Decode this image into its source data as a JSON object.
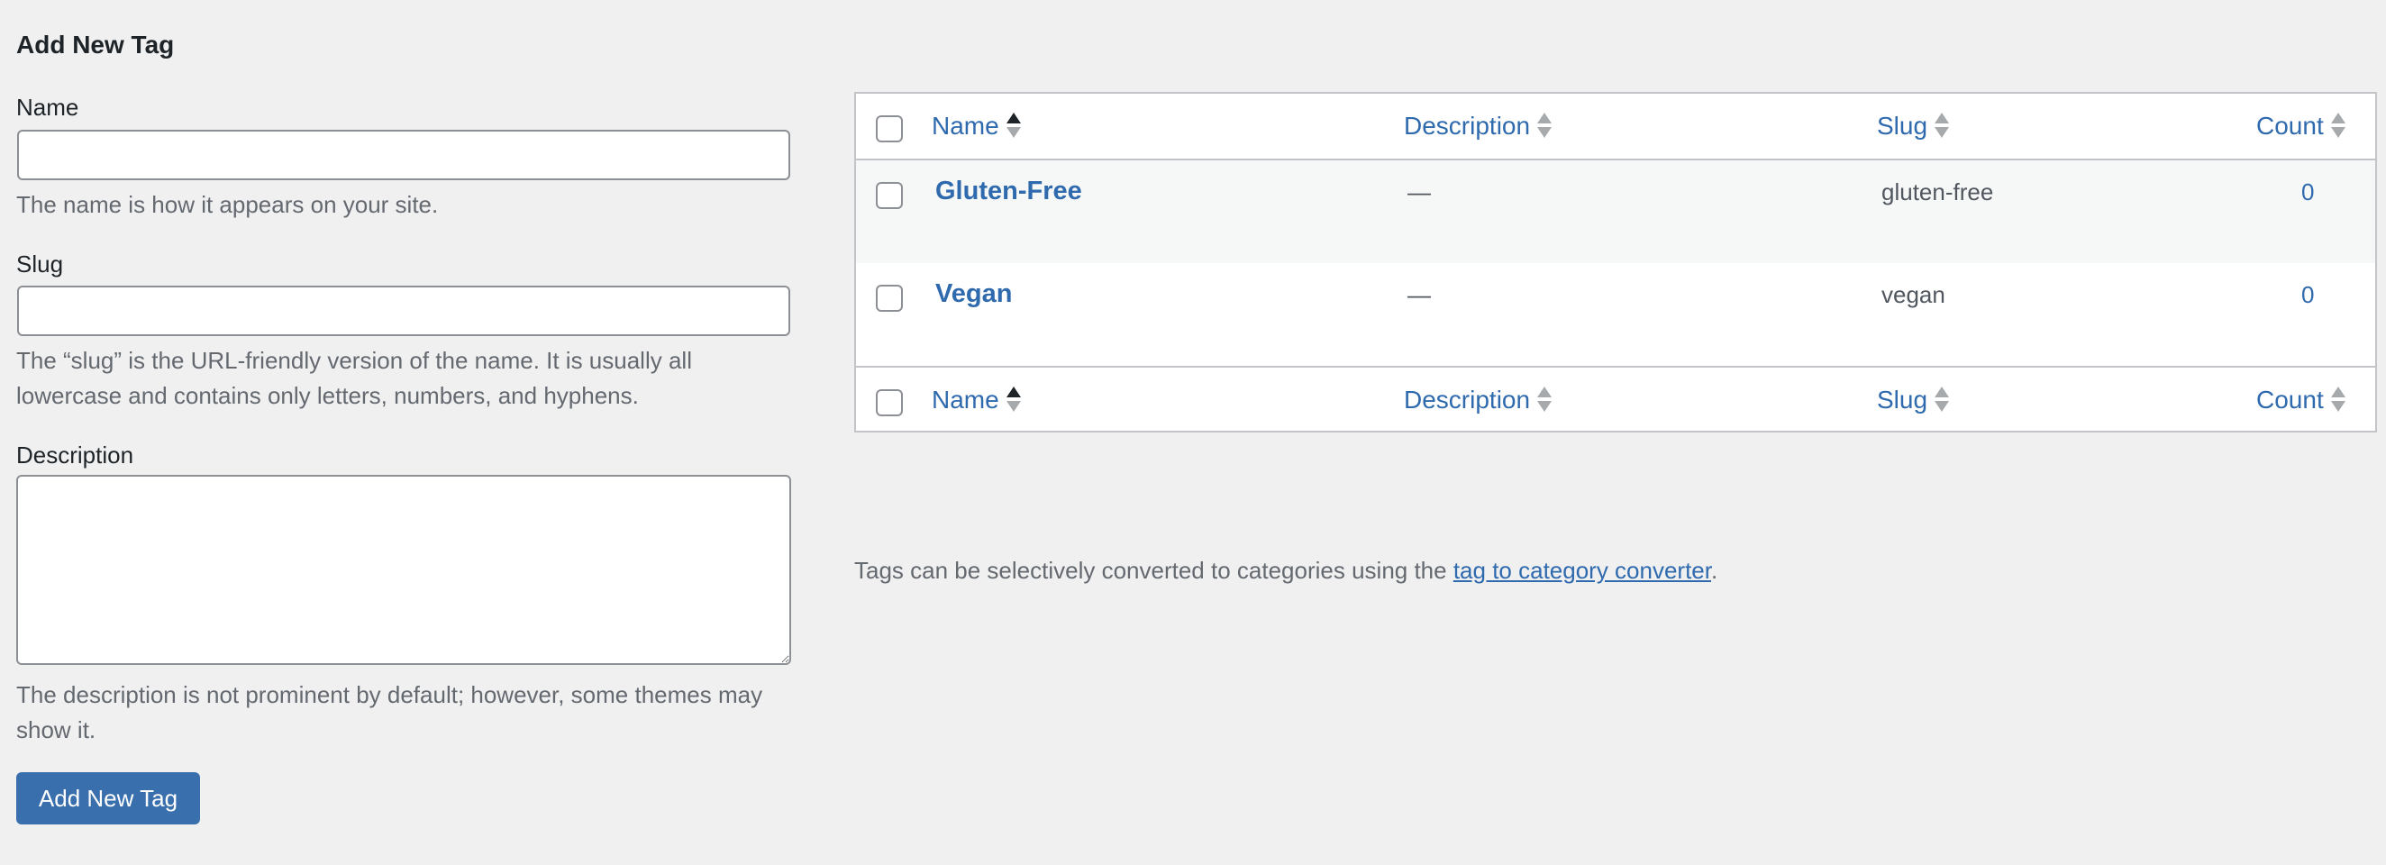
{
  "form": {
    "title": "Add New Tag",
    "name_label": "Name",
    "name_value": "",
    "name_help": "The name is how it appears on your site.",
    "slug_label": "Slug",
    "slug_value": "",
    "slug_help": "The “slug” is the URL-friendly version of the name. It is usually all lowercase and contains only letters, numbers, and hyphens.",
    "description_label": "Description",
    "description_value": "",
    "description_help": "The description is not prominent by default; however, some themes may show it.",
    "submit_label": "Add New Tag",
    "accent_color": "#3a6fad"
  },
  "table": {
    "columns": [
      {
        "label": "Name",
        "sort": "ascending"
      },
      {
        "label": "Description",
        "sort": "none"
      },
      {
        "label": "Slug",
        "sort": "none"
      },
      {
        "label": "Count",
        "sort": "none"
      }
    ],
    "rows": [
      {
        "name": "Gluten-Free",
        "description": "—",
        "slug": "gluten-free",
        "count": "0"
      },
      {
        "name": "Vegan",
        "description": "—",
        "slug": "vegan",
        "count": "0"
      }
    ]
  },
  "note": {
    "text": "Tags can be selectively converted to categories using the ",
    "link": "tag to category converter",
    "suffix": "."
  }
}
